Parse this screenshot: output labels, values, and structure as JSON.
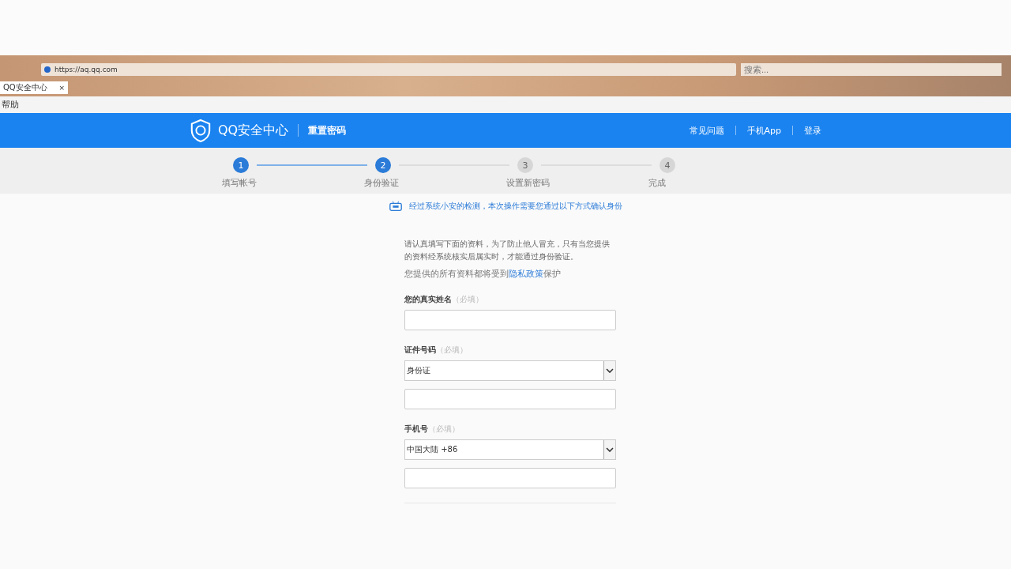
{
  "browser": {
    "address": "https://aq.qq.com",
    "search_placeholder": "搜索...",
    "tab": {
      "title": "QQ安全中心",
      "close": "×"
    },
    "menu": "帮助"
  },
  "header": {
    "logo": "QQ安全中心",
    "section": "重置密码",
    "nav": [
      "常见问题",
      "手机App",
      "登录"
    ]
  },
  "steps": [
    {
      "number": "1",
      "label": "填写帐号",
      "active": true
    },
    {
      "number": "2",
      "label": "身份验证",
      "active": true
    },
    {
      "number": "3",
      "label": "设置新密码",
      "active": false
    },
    {
      "number": "4",
      "label": "完成",
      "active": false
    }
  ],
  "notice": "经过系统小安的检测，本次操作需要您通过以下方式确认身份",
  "intro": "请认真填写下面的资料，为了防止他人冒充，只有当您提供的资料经系统核实后属实时，才能通过身份验证。",
  "privacy": {
    "text": "您提供的所有资料都将受到",
    "link": "隐私政策",
    "after": "保护"
  },
  "fields": [
    {
      "kind": "text",
      "label": "您的真实姓名",
      "hint": "（必填）"
    },
    {
      "kind": "select-text",
      "label": "证件号码",
      "hint": "（必填）",
      "option": "身份证"
    },
    {
      "kind": "select-text",
      "label": "手机号",
      "hint": "（必填）",
      "option": "中国大陆 +86"
    }
  ]
}
